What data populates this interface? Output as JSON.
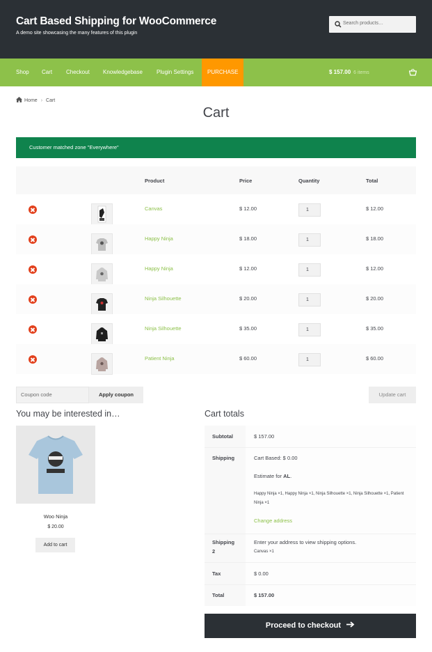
{
  "header": {
    "site_title": "Cart Based Shipping for WooCommerce",
    "site_description": "A demo site showcasing the many features of this plugin",
    "search_placeholder": "Search products…"
  },
  "nav": {
    "items": [
      {
        "label": "Shop"
      },
      {
        "label": "Cart"
      },
      {
        "label": "Checkout"
      },
      {
        "label": "Knowledgebase"
      },
      {
        "label": "Plugin Settings"
      },
      {
        "label": "PURCHASE"
      }
    ],
    "cart_total": "$ 157.00",
    "cart_count": "6 items"
  },
  "breadcrumb": {
    "home": "Home",
    "current": "Cart"
  },
  "page_title": "Cart",
  "notice": "Customer matched zone \"Everywhere\"",
  "cart": {
    "headers": {
      "product": "Product",
      "price": "Price",
      "quantity": "Quantity",
      "total": "Total"
    },
    "rows": [
      {
        "name": "Canvas",
        "price": "$ 12.00",
        "qty": "1",
        "total": "$ 12.00",
        "thumb": "poster-icon"
      },
      {
        "name": "Happy Ninja",
        "price": "$ 18.00",
        "qty": "1",
        "total": "$ 18.00",
        "thumb": "tshirt-grey-icon"
      },
      {
        "name": "Happy Ninja",
        "price": "$ 12.00",
        "qty": "1",
        "total": "$ 12.00",
        "thumb": "hoodie-grey-icon"
      },
      {
        "name": "Ninja Silhouette",
        "price": "$ 20.00",
        "qty": "1",
        "total": "$ 20.00",
        "thumb": "tshirt-black-icon"
      },
      {
        "name": "Ninja Silhouette",
        "price": "$ 35.00",
        "qty": "1",
        "total": "$ 35.00",
        "thumb": "hoodie-black-icon"
      },
      {
        "name": "Patient Ninja",
        "price": "$ 60.00",
        "qty": "1",
        "total": "$ 60.00",
        "thumb": "hoodie-pink-icon"
      }
    ],
    "coupon_placeholder": "Coupon code",
    "apply_coupon": "Apply coupon",
    "update_cart": "Update cart"
  },
  "cross_sells": {
    "title": "You may be interested in…",
    "product": {
      "name": "Woo Ninja",
      "price": "$ 20.00",
      "button": "Add to cart"
    }
  },
  "totals": {
    "title": "Cart totals",
    "subtotal_label": "Subtotal",
    "subtotal_value": "$ 157.00",
    "shipping_label": "Shipping",
    "shipping_value": "Cart Based: $ 0.00",
    "estimate_prefix": "Estimate for ",
    "estimate_location": "AL",
    "estimate_suffix": ".",
    "shipping_items": "Happy Ninja ×1, Happy Ninja ×1, Ninja Silhouette ×1, Ninja Silhouette ×1, Patient Ninja ×1",
    "change_address": "Change address",
    "shipping2_label_a": "Shipping",
    "shipping2_label_b": "2",
    "shipping2_value": "Enter your address to view shipping options.",
    "shipping2_items": "Canvas ×1",
    "tax_label": "Tax",
    "tax_value": "$ 0.00",
    "total_label": "Total",
    "total_value": "$ 157.00"
  },
  "checkout_button": "Proceed to checkout",
  "colors": {
    "header": "#2b3035",
    "nav": "#8dc14a",
    "purchase": "#ff9800",
    "notice": "#0f834d",
    "remove": "#e2401c",
    "link": "#8dc14a"
  }
}
